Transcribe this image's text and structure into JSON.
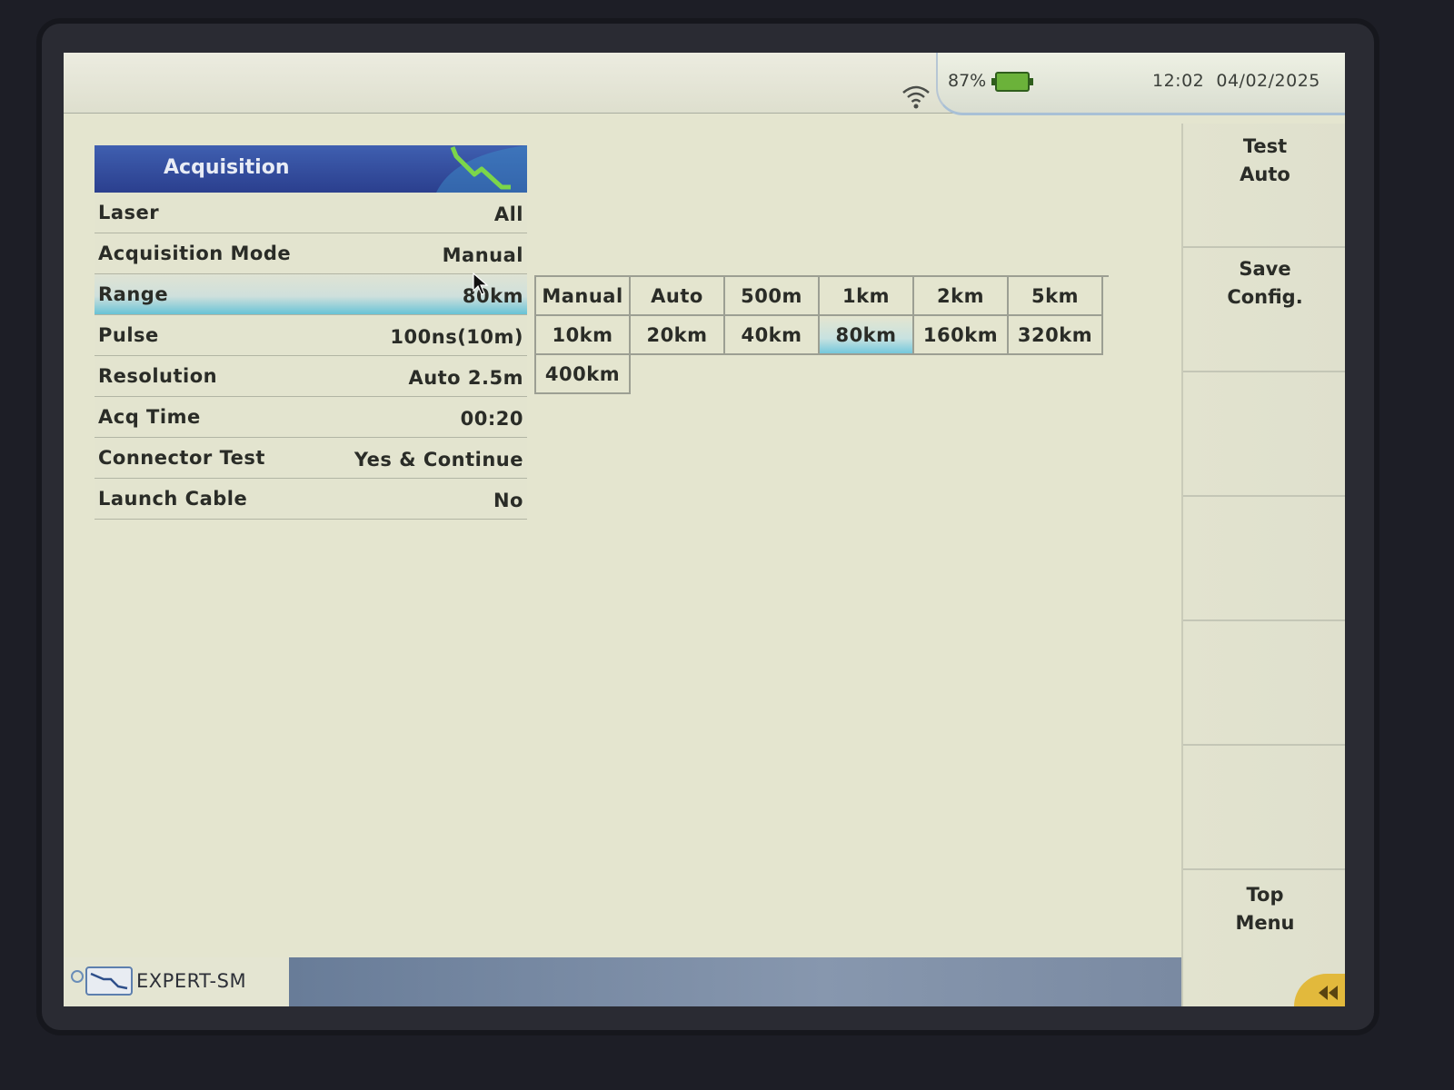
{
  "status": {
    "battery_pct": "87%",
    "time": "12:02",
    "date": "04/02/2025"
  },
  "panel": {
    "title": "Acquisition",
    "rows": [
      {
        "label": "Laser",
        "value": "All"
      },
      {
        "label": "Acquisition Mode",
        "value": "Manual"
      },
      {
        "label": "Range",
        "value": "80km",
        "selected": true
      },
      {
        "label": "Pulse",
        "value": "100ns(10m)"
      },
      {
        "label": "Resolution",
        "value": "Auto 2.5m"
      },
      {
        "label": "Acq Time",
        "value": "00:20"
      },
      {
        "label": "Connector Test",
        "value": "Yes & Continue"
      },
      {
        "label": "Launch Cable",
        "value": "No"
      }
    ]
  },
  "range_options": [
    "Manual",
    "Auto",
    "500m",
    "1km",
    "2km",
    "5km",
    "10km",
    "20km",
    "40km",
    "80km",
    "160km",
    "320km",
    "400km"
  ],
  "range_selected": "80km",
  "softkeys": {
    "test_auto": [
      "Test",
      "Auto"
    ],
    "save_config": [
      "Save",
      "Config."
    ],
    "top_menu": [
      "Top",
      "Menu"
    ]
  },
  "bottom": {
    "app_label": "EXPERT-SM"
  },
  "colors": {
    "header_blue": "#2b3f8e",
    "selection_cyan": "#68c3d6",
    "battery_green": "#6bb23a",
    "screen_bg": "#e4e5cf"
  },
  "icons": [
    "wifi-icon",
    "battery-icon",
    "trace-icon",
    "mouse-cursor-icon",
    "fiber-trace-icon",
    "back-arrow-icon"
  ]
}
